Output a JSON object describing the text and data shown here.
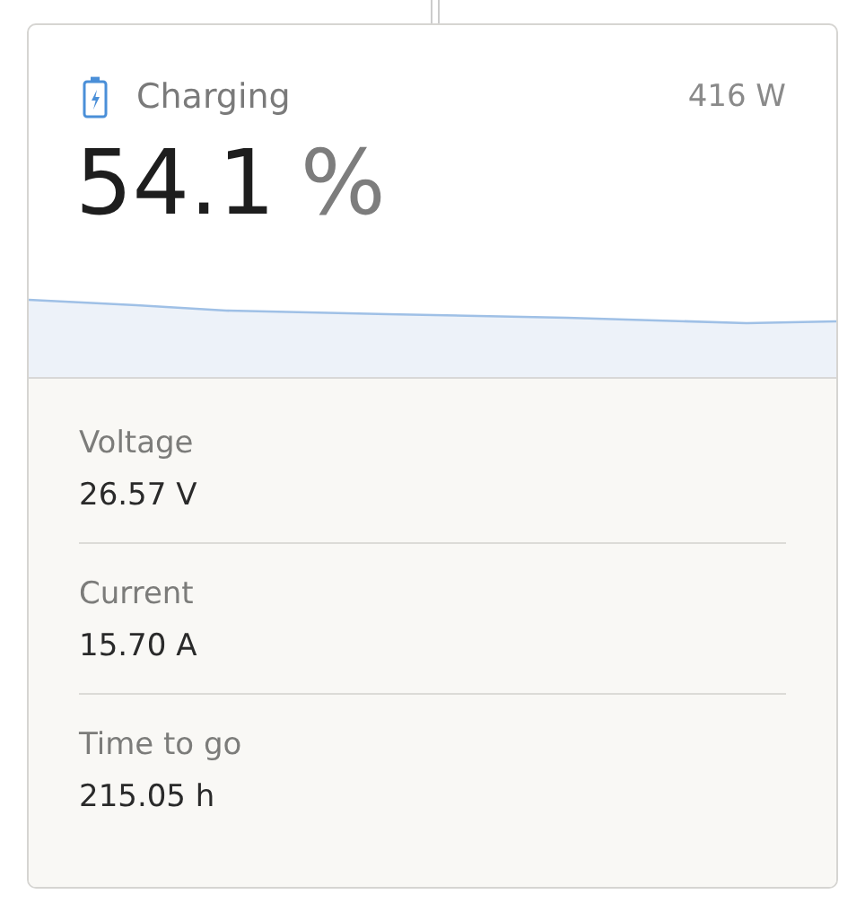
{
  "battery": {
    "state": "Charging",
    "power": "416 W",
    "soc": "54.1",
    "unit": "%"
  },
  "metrics": [
    {
      "label": "Voltage",
      "value": "26.57 V"
    },
    {
      "label": "Current",
      "value": "15.70 A"
    },
    {
      "label": "Time to go",
      "value": "215.05 h"
    }
  ]
}
